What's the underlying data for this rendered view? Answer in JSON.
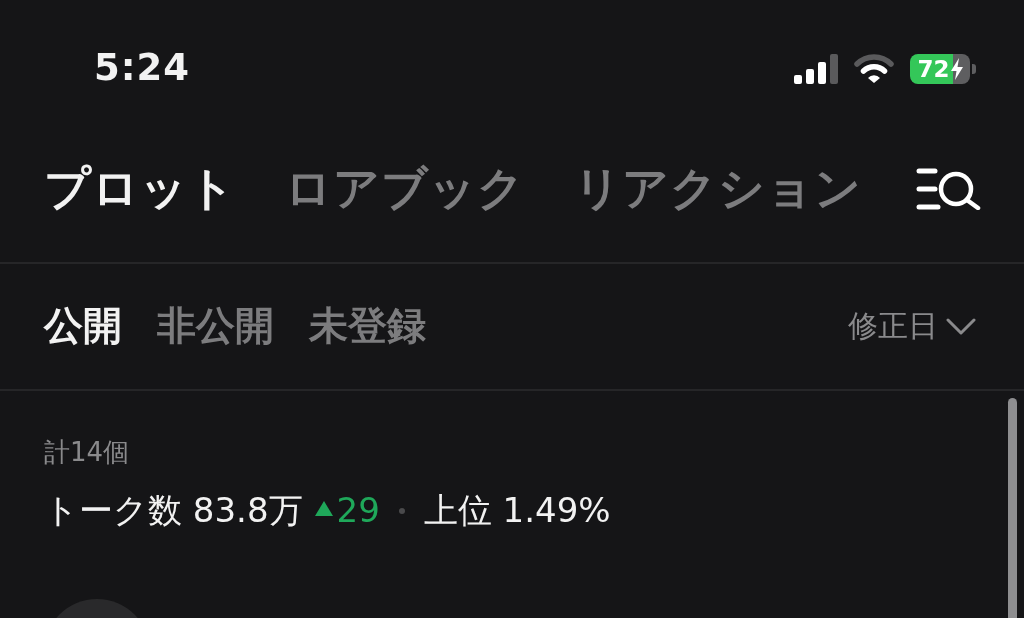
{
  "status_bar": {
    "time": "5:24",
    "battery": "72"
  },
  "tabs": [
    {
      "label": "プロット",
      "selected": true
    },
    {
      "label": "ロアブック",
      "selected": false
    },
    {
      "label": "リアクション",
      "selected": false
    }
  ],
  "filters": [
    {
      "label": "公開",
      "selected": true
    },
    {
      "label": "非公開",
      "selected": false
    },
    {
      "label": "未登録",
      "selected": false
    }
  ],
  "sort": {
    "label": "修正日"
  },
  "summary": {
    "count": "計14個",
    "talks": "トーク数 83.8万",
    "change": "29",
    "rank": "上位 1.49%"
  }
}
